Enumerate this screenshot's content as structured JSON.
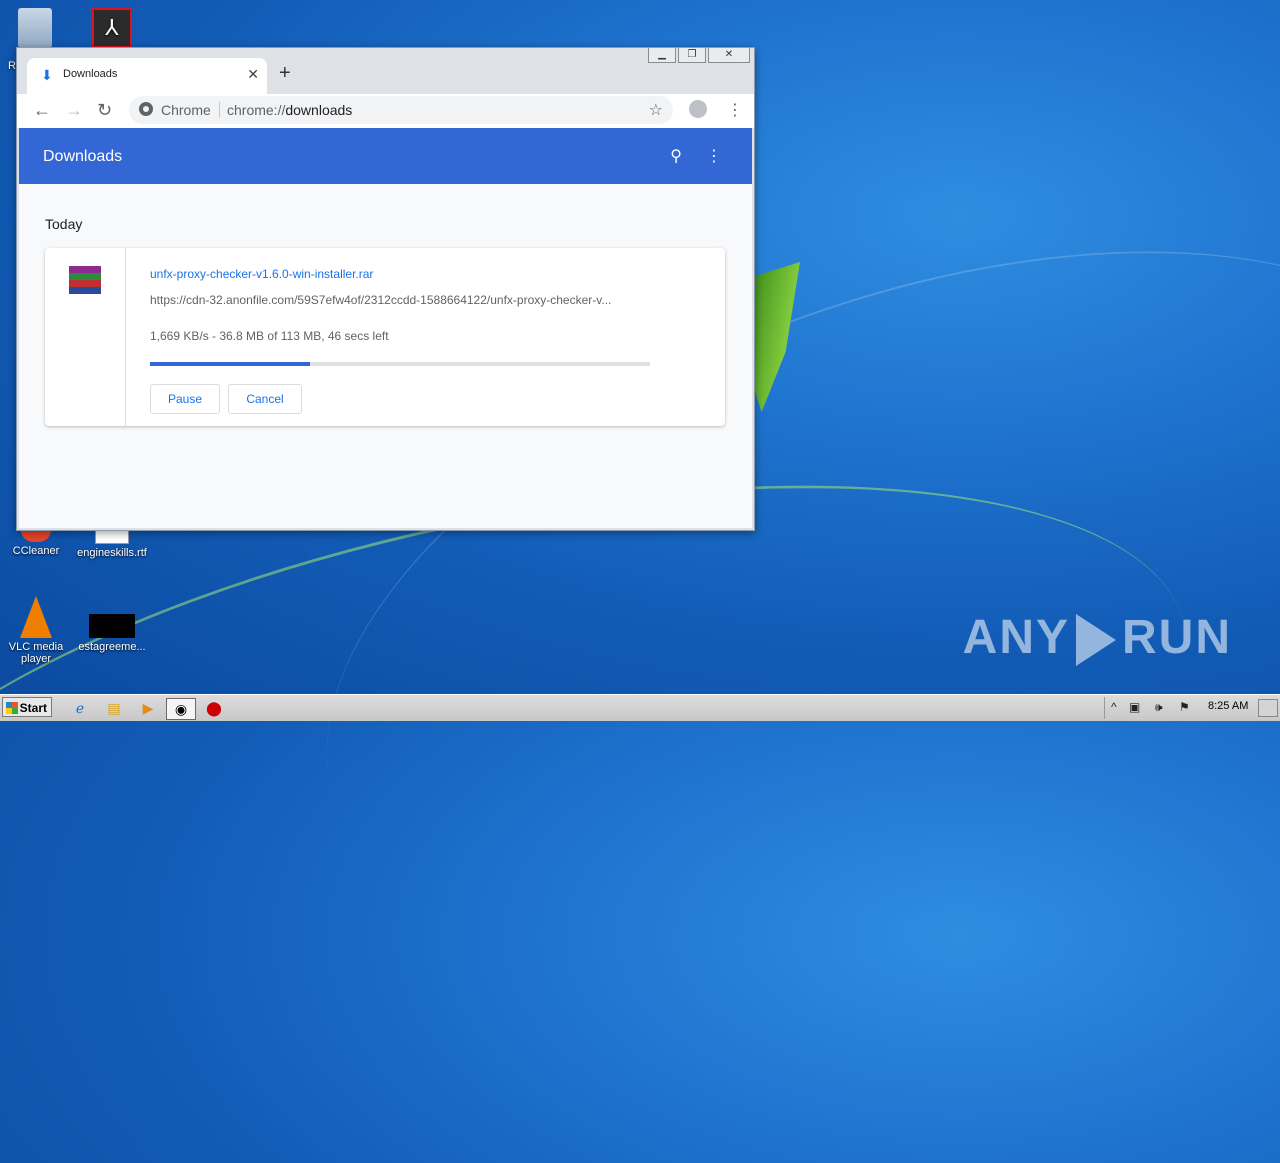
{
  "desktop": {
    "icons": [
      {
        "label": "R",
        "id": "recycle"
      },
      {
        "label": "CCleaner",
        "id": "ccleaner"
      },
      {
        "label": "engineskills.rtf",
        "id": "engineskills"
      },
      {
        "label": "VLC media player",
        "id": "vlc"
      },
      {
        "label": "estagreeme...",
        "id": "estagreeme"
      }
    ],
    "watermark": {
      "left": "ANY",
      "right": "RUN"
    }
  },
  "window": {
    "controls": [
      "minimize",
      "restore",
      "close"
    ]
  },
  "tab": {
    "title": "Downloads",
    "icon": "download-icon"
  },
  "toolbar": {
    "site_label": "Chrome",
    "url_scheme": "chrome://",
    "url_path": "downloads"
  },
  "downloads_page": {
    "header_title": "Downloads",
    "section_label": "Today",
    "item": {
      "file_name": "unfx-proxy-checker-v1.6.0-win-installer.rar",
      "url": "https://cdn-32.anonfile.com/59S7efw4of/2312ccdd-1588664122/unfx-proxy-checker-v...",
      "status": "1,669 KB/s - 36.8 MB of 113 MB, 46 secs left",
      "progress_fraction": 0.32,
      "pause_label": "Pause",
      "cancel_label": "Cancel"
    }
  },
  "taskbar": {
    "start_label": "Start",
    "clock": "8:25 AM"
  }
}
